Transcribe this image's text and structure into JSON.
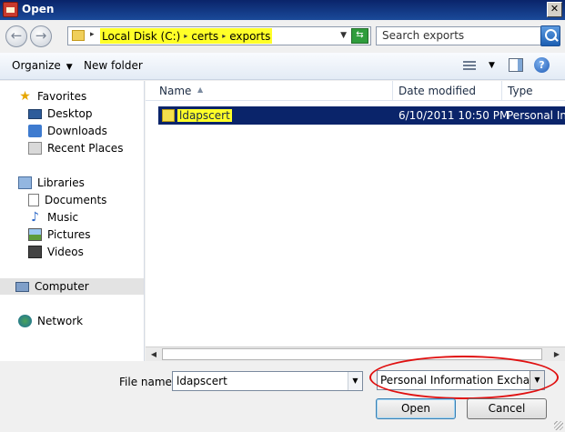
{
  "window": {
    "title": "Open"
  },
  "address": {
    "crumbs": [
      "Local Disk (C:)",
      "certs",
      "exports"
    ],
    "search_placeholder": "Search exports"
  },
  "toolbar": {
    "organize": "Organize",
    "new_folder": "New folder"
  },
  "nav": {
    "favorites": "Favorites",
    "desktop": "Desktop",
    "downloads": "Downloads",
    "recent": "Recent Places",
    "libraries": "Libraries",
    "documents": "Documents",
    "music": "Music",
    "pictures": "Pictures",
    "videos": "Videos",
    "computer": "Computer",
    "network": "Network"
  },
  "columns": {
    "name": "Name",
    "date": "Date modified",
    "type": "Type"
  },
  "files": [
    {
      "name": "ldapscert",
      "date": "6/10/2011 10:50 PM",
      "type": "Personal Info"
    }
  ],
  "footer": {
    "file_name_label": "File name:",
    "file_name_value": "ldapscert",
    "file_type_value": "Personal Information Exchange",
    "open_label": "Open",
    "cancel_label": "Cancel"
  },
  "colors": {
    "highlight": "#ffff28",
    "annotation": "#e01010",
    "selection": "#0a246a"
  }
}
